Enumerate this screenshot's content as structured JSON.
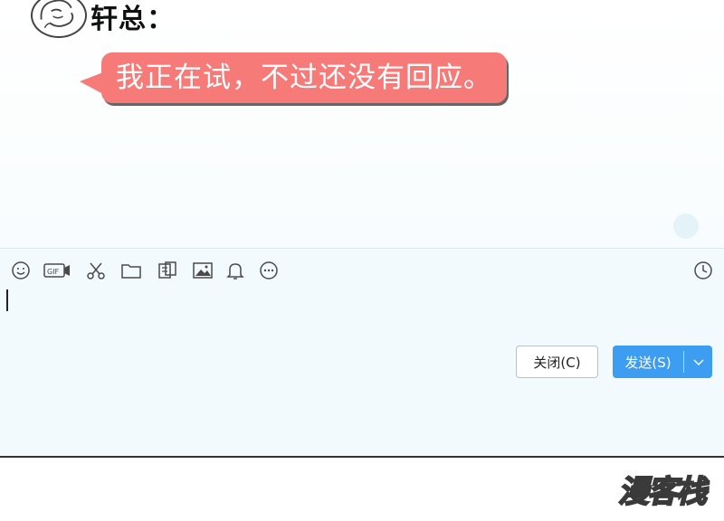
{
  "conversation": {
    "sender_name": "轩总：",
    "message_text": "我正在试，不过还没有回应。"
  },
  "composer": {
    "toolbar_icons": [
      "emoji-icon",
      "gif-icon",
      "scissors-icon",
      "folder-icon",
      "file-transfer-icon",
      "image-icon",
      "bell-icon",
      "more-icon",
      "history-icon"
    ],
    "input_value": "",
    "close_label": "关闭(C)",
    "send_label": "发送(S)"
  },
  "watermark": {
    "text": "漫客栈"
  },
  "colors": {
    "bubble": "#f57a78",
    "send_button": "#3d9df0",
    "input_bg": "#f2fafd"
  }
}
